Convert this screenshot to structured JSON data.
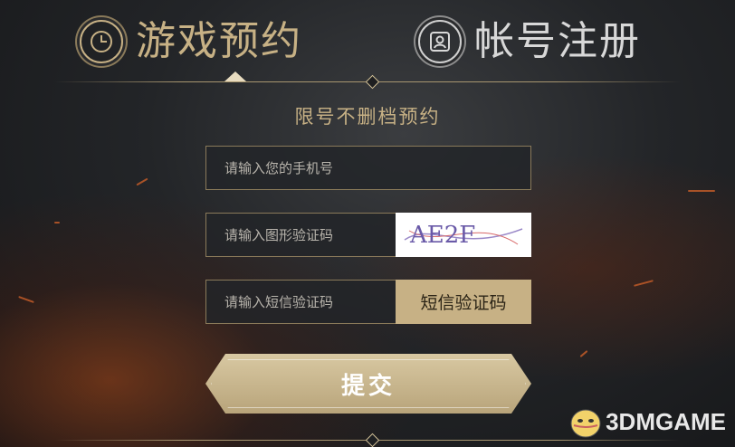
{
  "tabs": [
    {
      "label": "游戏预约",
      "icon": "clock-icon",
      "active": true
    },
    {
      "label": "帐号注册",
      "icon": "user-card-icon",
      "active": false
    }
  ],
  "form": {
    "title": "限号不删档预约",
    "phone_placeholder": "请输入您的手机号",
    "captcha_placeholder": "请输入图形验证码",
    "captcha_text": "AE2F",
    "sms_placeholder": "请输入短信验证码",
    "sms_button": "短信验证码",
    "submit": "提交"
  },
  "watermark": {
    "brand": "3DMGAME"
  },
  "colors": {
    "accent_gold": "#c7b185",
    "field_border": "#8a7a5a",
    "bg_dark": "#232528"
  }
}
